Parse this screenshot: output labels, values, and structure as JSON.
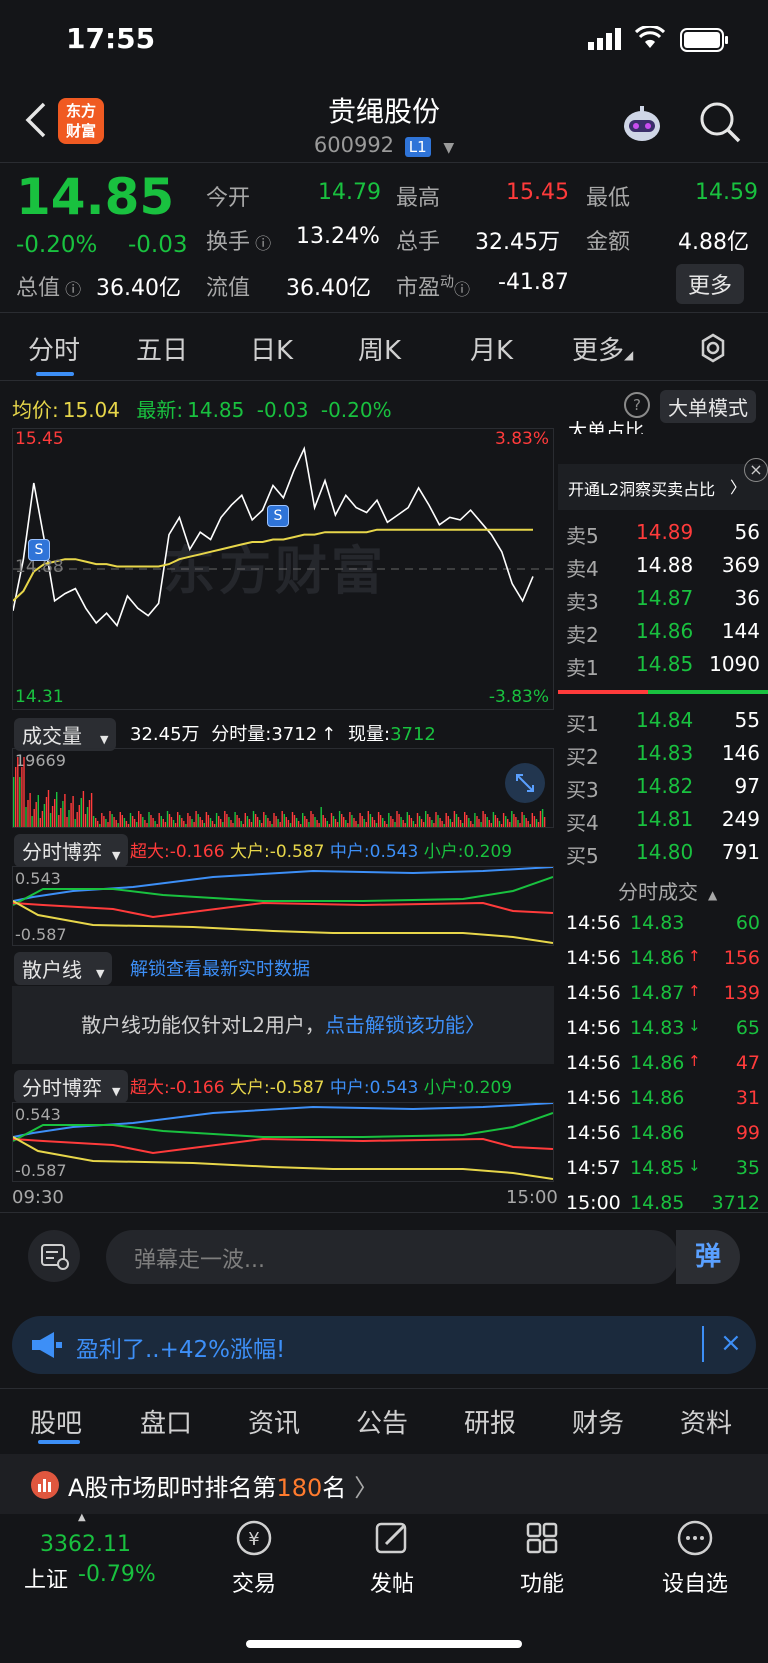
{
  "status_bar": {
    "time": "17:55"
  },
  "header": {
    "title": "贵绳股份",
    "code": "600992",
    "level": "L1",
    "logo_text": "东方财富"
  },
  "quote": {
    "price": "14.85",
    "change_pct": "-0.20%",
    "change": "-0.03",
    "open_label": "今开",
    "open": "14.79",
    "high_label": "最高",
    "high": "15.45",
    "low_label": "最低",
    "low": "14.59",
    "turnover_label": "换手",
    "turnover": "13.24%",
    "volume_label": "总手",
    "volume": "32.45万",
    "amount_label": "金额",
    "amount": "4.88亿",
    "mcap_label": "总值",
    "mcap": "36.40亿",
    "float_label": "流值",
    "float_val": "36.40亿",
    "pe_label": "市盈",
    "pe_sup": "动",
    "pe": "-41.87",
    "more_label": "更多"
  },
  "tabs": [
    "分时",
    "五日",
    "日K",
    "周K",
    "月K",
    "更多"
  ],
  "chart_info": {
    "avg_label": "均价:",
    "avg": "15.04",
    "latest_label": "最新:",
    "latest": "14.85",
    "latest_chg": "-0.03",
    "latest_pct": "-0.20%",
    "mode_button": "大单模式",
    "y_top": "15.45",
    "y_mid": "14.88",
    "y_bottom": "14.31",
    "pct_top": "3.83%",
    "pct_bottom": "-3.83%",
    "watermark": "东方财富"
  },
  "chart_data": {
    "type": "line",
    "title": "",
    "ylim": [
      14.31,
      15.45
    ],
    "x_start": "09:30",
    "x_end": "15:00",
    "series": [
      {
        "values": [
          14.71,
          14.92,
          15.23,
          15.0,
          14.75,
          14.78,
          14.8,
          14.72,
          14.66,
          14.7,
          14.65,
          14.77,
          14.72,
          14.69,
          14.74,
          15.02,
          15.09,
          14.96,
          15.03,
          15.0,
          15.09,
          15.14,
          15.18,
          15.08,
          15.12,
          15.22,
          15.17,
          15.28,
          15.37,
          15.13,
          15.24,
          15.1,
          15.18,
          15.13,
          15.11,
          15.16,
          15.07,
          15.1,
          15.13,
          15.21,
          15.14,
          15.06,
          15.09,
          15.08,
          15.12,
          15.07,
          15.02,
          14.95,
          14.82,
          14.75,
          14.85
        ]
      },
      {
        "values": [
          14.75,
          14.79,
          14.87,
          14.9,
          14.91,
          14.92,
          14.92,
          14.91,
          14.9,
          14.9,
          14.89,
          14.89,
          14.89,
          14.89,
          14.89,
          14.9,
          14.92,
          14.93,
          14.94,
          14.95,
          14.96,
          14.97,
          14.98,
          14.99,
          14.99,
          15.0,
          15.0,
          15.01,
          15.02,
          15.02,
          15.03,
          15.03,
          15.03,
          15.03,
          15.03,
          15.04,
          15.04,
          15.04,
          15.04,
          15.04,
          15.04,
          15.04,
          15.04,
          15.04,
          15.04,
          15.04,
          15.04,
          15.04,
          15.04,
          15.04,
          15.04
        ]
      }
    ]
  },
  "volume_panel": {
    "label": "成交量",
    "total": "32.45万",
    "minute_label": "分时量:",
    "minute": "3712",
    "now_label": "现量:",
    "now": "3712",
    "max": "19669"
  },
  "game_panel": {
    "label": "分时博弈",
    "super_label": "超大:",
    "super": "-0.166",
    "big_label": "大户:",
    "big": "-0.587",
    "mid_label": "中户:",
    "mid": "0.543",
    "small_label": "小户:",
    "small": "0.209",
    "y_top": "0.543",
    "y_bottom": "-0.587"
  },
  "retail_panel": {
    "label": "散户线",
    "unlock": "解锁查看最新实时数据",
    "notice": "散户线功能仅针对L2用户，",
    "notice_link": "点击解锁该功能"
  },
  "time_axis": {
    "start": "09:30",
    "end": "15:00"
  },
  "side": {
    "big_ratio": "大单占比",
    "l2_link": "开通L2洞察买卖占比",
    "sell": [
      {
        "label": "卖5",
        "price": "14.89",
        "vol": "56",
        "color": "red"
      },
      {
        "label": "卖4",
        "price": "14.88",
        "vol": "369",
        "color": "white"
      },
      {
        "label": "卖3",
        "price": "14.87",
        "vol": "36",
        "color": "green"
      },
      {
        "label": "卖2",
        "price": "14.86",
        "vol": "144",
        "color": "green"
      },
      {
        "label": "卖1",
        "price": "14.85",
        "vol": "1090",
        "color": "green"
      }
    ],
    "buy": [
      {
        "label": "买1",
        "price": "14.84",
        "vol": "55",
        "color": "green"
      },
      {
        "label": "买2",
        "price": "14.83",
        "vol": "146",
        "color": "green"
      },
      {
        "label": "买3",
        "price": "14.82",
        "vol": "97",
        "color": "green"
      },
      {
        "label": "买4",
        "price": "14.81",
        "vol": "249",
        "color": "green"
      },
      {
        "label": "买5",
        "price": "14.80",
        "vol": "791",
        "color": "green"
      }
    ],
    "trades_label": "分时成交",
    "trades": [
      {
        "time": "14:56",
        "price": "14.83",
        "arrow": "",
        "vol": "60",
        "pc": "green",
        "vc": "green"
      },
      {
        "time": "14:56",
        "price": "14.86",
        "arrow": "↑",
        "vol": "156",
        "pc": "green",
        "vc": "red"
      },
      {
        "time": "14:56",
        "price": "14.87",
        "arrow": "↑",
        "vol": "139",
        "pc": "green",
        "vc": "red"
      },
      {
        "time": "14:56",
        "price": "14.83",
        "arrow": "↓",
        "vol": "65",
        "pc": "green",
        "vc": "green"
      },
      {
        "time": "14:56",
        "price": "14.86",
        "arrow": "↑",
        "vol": "47",
        "pc": "green",
        "vc": "red"
      },
      {
        "time": "14:56",
        "price": "14.86",
        "arrow": "",
        "vol": "31",
        "pc": "green",
        "vc": "red"
      },
      {
        "time": "14:56",
        "price": "14.86",
        "arrow": "",
        "vol": "99",
        "pc": "green",
        "vc": "red"
      },
      {
        "time": "14:57",
        "price": "14.85",
        "arrow": "↓",
        "vol": "35",
        "pc": "green",
        "vc": "green"
      },
      {
        "time": "15:00",
        "price": "14.85",
        "arrow": "",
        "vol": "3712",
        "pc": "green",
        "vc": "green"
      }
    ]
  },
  "danmaku": {
    "placeholder": "弹幕走一波...",
    "send": "弹"
  },
  "banner": {
    "text": "盈利了..+42%涨幅!"
  },
  "bottom_tabs": [
    "股吧",
    "盘口",
    "资讯",
    "公告",
    "研报",
    "财务",
    "资料"
  ],
  "rank": {
    "text_a": "A股市场即时排名第",
    "rank": "180",
    "text_b": "名"
  },
  "nav": {
    "index_value": "3362.11",
    "index_name": "上证",
    "index_pct": "-0.79%",
    "items": [
      "交易",
      "发帖",
      "功能",
      "设自选"
    ]
  }
}
